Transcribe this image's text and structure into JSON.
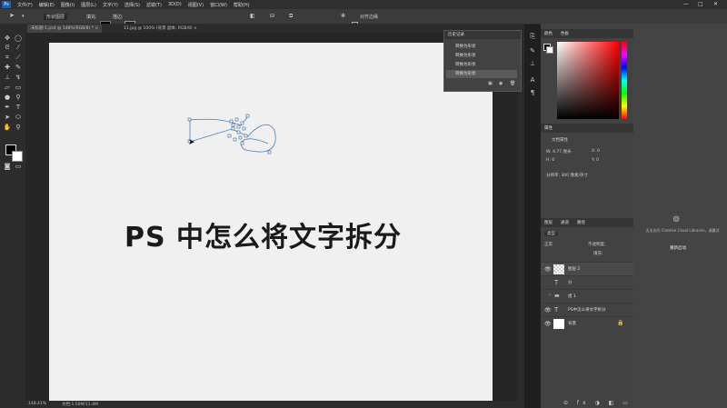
{
  "app": {
    "logo": "Ps",
    "window_controls": [
      "—",
      "□",
      "✕"
    ]
  },
  "menu": [
    "文件(F)",
    "编辑(E)",
    "图像(I)",
    "图层(L)",
    "文字(Y)",
    "选择(S)",
    "滤镜(T)",
    "3D(D)",
    "视图(V)",
    "窗口(W)",
    "帮助(H)"
  ],
  "options": {
    "shape_mode": "形状图层",
    "fill_label": "填充:",
    "stroke_label": "描边:",
    "align_edges": "对齐边缘"
  },
  "tabs": [
    {
      "label": "未标题-1.psd @ 148%(RGB/8) *",
      "close": "×"
    },
    {
      "label": "11.jpg @ 100% (背景 副本, RGB/8)",
      "close": "×"
    }
  ],
  "canvas_text": "PS 中怎么将文字拆分",
  "history": {
    "title": "历史记录",
    "items": [
      "转换为形状",
      "转换为形状",
      "转换为形状",
      "转换为形状"
    ],
    "selected_index": 3
  },
  "color_panel": {
    "tabs": [
      "颜色",
      "色板"
    ],
    "foreground": "#000000",
    "background": "#ffffff"
  },
  "properties": {
    "tabs": [
      "属性"
    ],
    "type_label": "文档属性",
    "w": "W: 4.77 厘米",
    "h": "H: 0",
    "x": "X: 0",
    "y": "Y: 0",
    "resolution": "分辨率: 300 像素/英寸"
  },
  "layers_panel": {
    "tabs": [
      "图层",
      "通道",
      "路径"
    ],
    "kind_label": "类型",
    "blend_mode": "正常",
    "opacity_label": "不透明度:",
    "fill_label": "填充:",
    "layers": [
      {
        "name": "图层 2",
        "type": "pixel",
        "visible": true
      },
      {
        "name": "分",
        "type": "text",
        "visible": false
      },
      {
        "name": "组 1",
        "type": "group",
        "visible": false
      },
      {
        "name": "PS中怎么将文字拆分",
        "type": "text",
        "visible": true
      },
      {
        "name": "背景",
        "type": "background",
        "visible": true
      }
    ]
  },
  "creative_cloud": {
    "text": "无法访问 Creative Cloud Libraries，请重试",
    "button": "重新启动"
  },
  "status": {
    "zoom": "148.41%",
    "doc": "文档:1.50M/11.4M"
  }
}
